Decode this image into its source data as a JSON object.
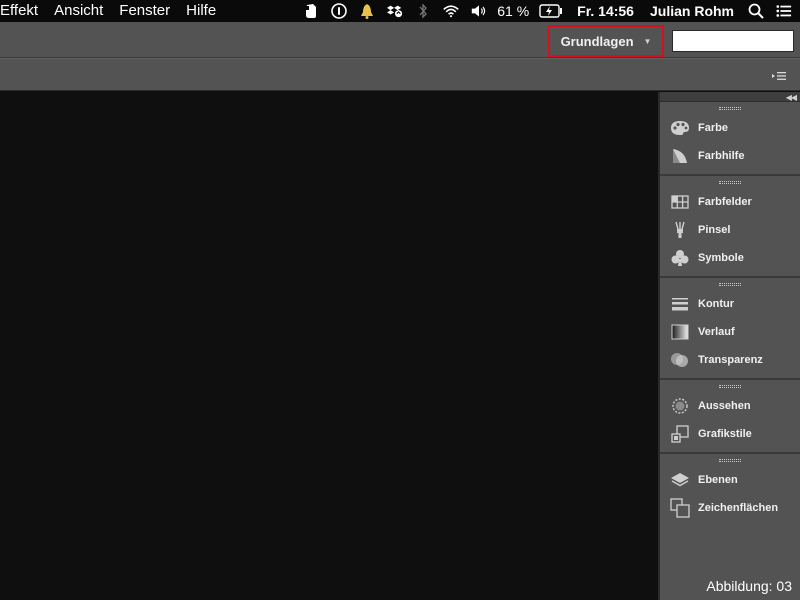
{
  "menubar": {
    "menus": [
      "Effekt",
      "Ansicht",
      "Fenster",
      "Hilfe"
    ],
    "status_icons": [
      "evernote-icon",
      "info-circle-icon",
      "bell-icon",
      "dropbox-sync-icon",
      "bluetooth-icon",
      "wifi-icon",
      "volume-icon"
    ],
    "battery_percent": "61 %",
    "clock": "Fr. 14:56",
    "user": "Julian Rohm"
  },
  "appbar": {
    "workspace": "Grundlagen",
    "search_placeholder": ""
  },
  "panels": {
    "groups": [
      {
        "items": [
          {
            "label": "Farbe",
            "icon": "palette-icon"
          },
          {
            "label": "Farbhilfe",
            "icon": "color-guide-icon"
          }
        ]
      },
      {
        "items": [
          {
            "label": "Farbfelder",
            "icon": "swatches-icon"
          },
          {
            "label": "Pinsel",
            "icon": "brush-icon"
          },
          {
            "label": "Symbole",
            "icon": "club-symbol-icon"
          }
        ]
      },
      {
        "items": [
          {
            "label": "Kontur",
            "icon": "stroke-lines-icon"
          },
          {
            "label": "Verlauf",
            "icon": "gradient-icon"
          },
          {
            "label": "Transparenz",
            "icon": "transparency-icon"
          }
        ]
      },
      {
        "items": [
          {
            "label": "Aussehen",
            "icon": "appearance-icon"
          },
          {
            "label": "Grafikstile",
            "icon": "graphic-styles-icon"
          }
        ]
      },
      {
        "items": [
          {
            "label": "Ebenen",
            "icon": "layers-icon"
          },
          {
            "label": "Zeichenflächen",
            "icon": "artboards-icon"
          }
        ]
      }
    ]
  },
  "caption": "Abbildung: 03",
  "colors": {
    "highlight_border": "#d4111d",
    "panel_bg": "#535353",
    "canvas_bg": "#0f0f0f"
  }
}
